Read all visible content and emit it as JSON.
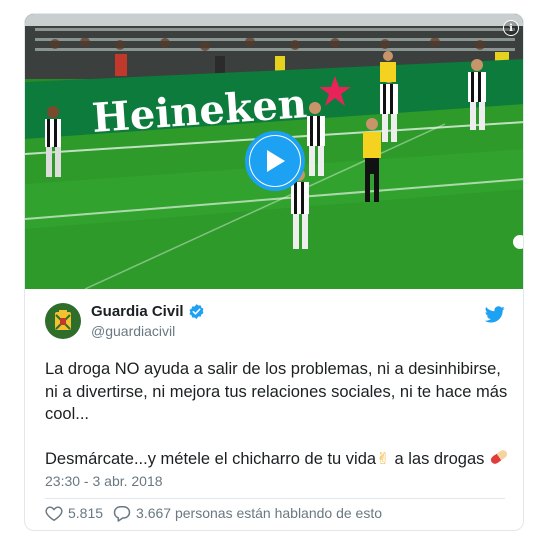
{
  "tweet": {
    "author": {
      "display_name": "Guardia Civil",
      "handle": "@guardiacivil",
      "verified": true,
      "avatar_icon": "guardia-civil-emblem"
    },
    "text_line1": "La droga NO ayuda a salir de los problemas, ni a desinhibirse, ni a divertirse, ni mejora tus relaciones sociales, ni te hace más cool...",
    "text_line2_before": "Desmárcate...y métele el chicharro de tu vida",
    "text_line2_emoji1": "✌",
    "text_line2_after": " a las drogas ",
    "text_line2_emoji2_icon": "pill-icon",
    "timestamp": "23:30 - 3 abr. 2018",
    "likes": "5.815",
    "talking": "3.667 personas están hablando de esto"
  },
  "media": {
    "type": "video",
    "banner_text": "Heineken",
    "info_icon": "ℹ"
  },
  "colors": {
    "twitter_blue": "#1da1f2",
    "pitch_green": "#2a8a25",
    "banner_green": "#0d7b3b",
    "heineken_star": "#e8235a",
    "text_primary": "#1c2022",
    "text_secondary": "#697882"
  }
}
